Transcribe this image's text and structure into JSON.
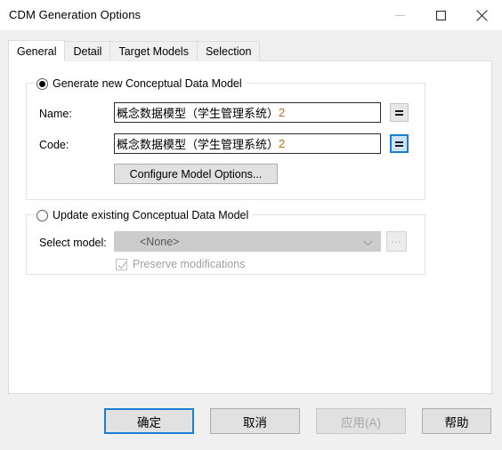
{
  "window": {
    "title": "CDM Generation Options",
    "controls": {
      "minimize": "minimize-icon",
      "maximize": "maximize-icon",
      "close": "close-icon"
    }
  },
  "tabs": [
    {
      "label": "General",
      "active": true
    },
    {
      "label": "Detail",
      "active": false
    },
    {
      "label": "Target Models",
      "active": false
    },
    {
      "label": "Selection",
      "active": false
    }
  ],
  "generate_group": {
    "radio_label": "Generate new Conceptual Data Model",
    "radio_selected": true,
    "name_label": "Name:",
    "name_value_text": "概念数据模型（学生管理系统）",
    "name_value_suffix": "2",
    "name_equals_button": "=",
    "code_label": "Code:",
    "code_value_text": "概念数据模型（学生管理系统）",
    "code_value_suffix": "2",
    "code_equals_button": "=",
    "configure_button": "Configure Model Options..."
  },
  "update_group": {
    "radio_label": "Update existing Conceptual Data Model",
    "radio_selected": false,
    "select_model_label": "Select model:",
    "select_model_value": "<None>",
    "browse_button": "...",
    "preserve_label": "Preserve modifications",
    "preserve_checked": true
  },
  "buttons": {
    "ok": "确定",
    "cancel": "取消",
    "apply": "应用(A)",
    "help": "帮助"
  },
  "colors": {
    "accent": "#1a7fd4",
    "focus_fill": "#cce4f7",
    "value_number": "#c46a18",
    "disabled_text": "#a6a6a6",
    "panel_bg": "#ffffff",
    "dialog_bg": "#f0f0f0"
  }
}
